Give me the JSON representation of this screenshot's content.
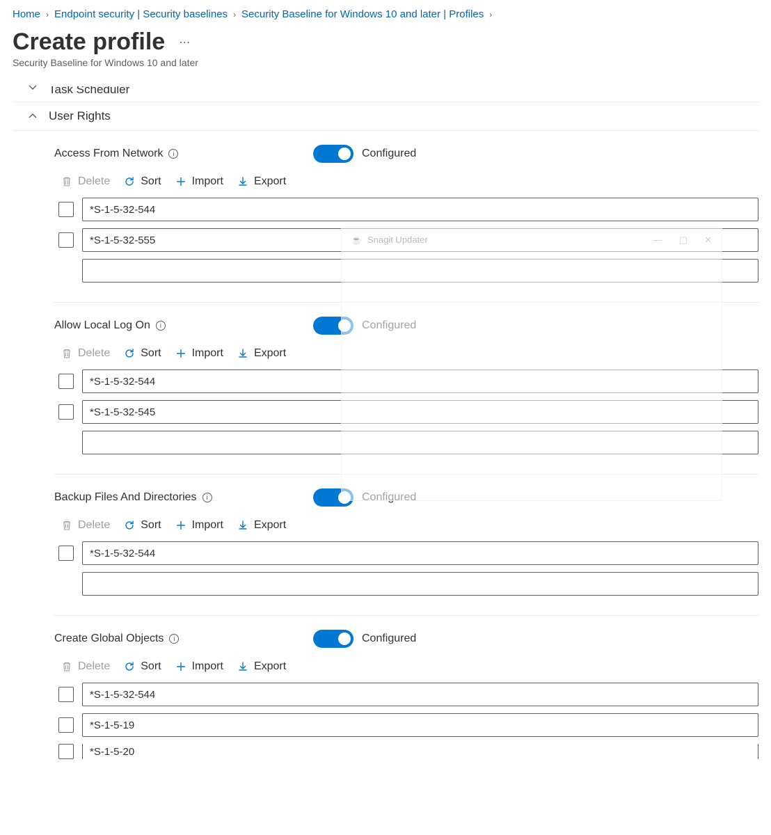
{
  "breadcrumb": {
    "items": [
      "Home",
      "Endpoint security | Security baselines",
      "Security Baseline for Windows 10 and later | Profiles"
    ]
  },
  "header": {
    "title": "Create profile",
    "subtitle": "Security Baseline for Windows 10 and later"
  },
  "sections": {
    "collapsed": {
      "label": "Task Scheduler"
    },
    "expanded": {
      "label": "User Rights"
    }
  },
  "actions": {
    "delete": "Delete",
    "sort": "Sort",
    "import": "Import",
    "export": "Export"
  },
  "toggle_label": "Configured",
  "settings": [
    {
      "name": "Access From Network",
      "entries": [
        "*S-1-5-32-544",
        "*S-1-5-32-555"
      ]
    },
    {
      "name": "Allow Local Log On",
      "entries": [
        "*S-1-5-32-544",
        "*S-1-5-32-545"
      ]
    },
    {
      "name": "Backup Files And Directories",
      "entries": [
        "*S-1-5-32-544"
      ]
    },
    {
      "name": "Create Global Objects",
      "entries": [
        "*S-1-5-32-544",
        "*S-1-5-19",
        "*S-1-5-20"
      ]
    }
  ],
  "ghost_popup": {
    "title": "Snagit Updater"
  }
}
